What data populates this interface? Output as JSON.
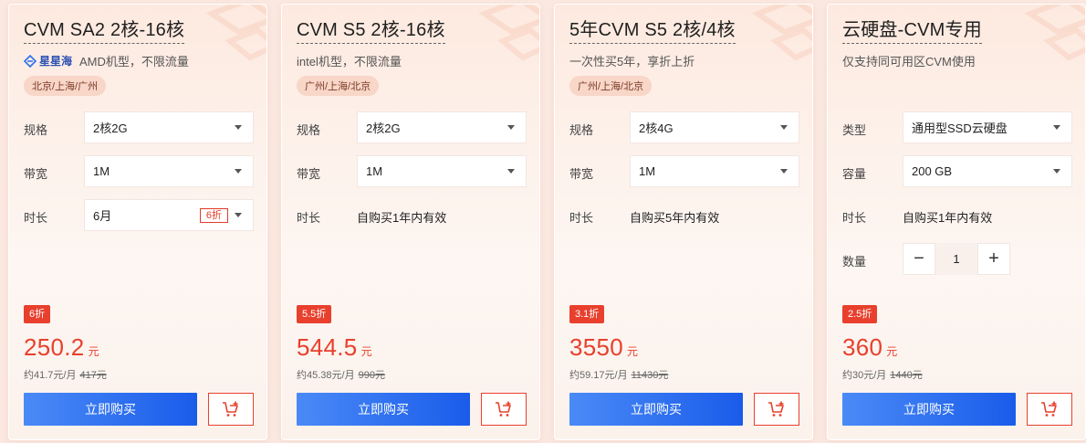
{
  "colors": {
    "accent": "#e8402d",
    "button_blue": "#1a5cea",
    "region_bg": "#f8d6c8"
  },
  "cards": [
    {
      "title": "CVM SA2 2核-16核",
      "brand": "星星海",
      "subtitle": "AMD机型，不限流量",
      "region": "北京/上海/广州",
      "spec_label": "规格",
      "spec_value": "2核2G",
      "bandwidth_label": "带宽",
      "bandwidth_value": "1M",
      "duration_label": "时长",
      "duration_value": "6月",
      "duration_tag": "6折",
      "discount": "6折",
      "price": "250.2",
      "price_unit": "元",
      "per_month": "约41.7元/月",
      "original": "417元",
      "buy_label": "立即购买"
    },
    {
      "title": "CVM S5 2核-16核",
      "subtitle": "intel机型，不限流量",
      "region": "广州/上海/北京",
      "spec_label": "规格",
      "spec_value": "2核2G",
      "bandwidth_label": "带宽",
      "bandwidth_value": "1M",
      "duration_label": "时长",
      "duration_value": "自购买1年内有效",
      "discount": "5.5折",
      "price": "544.5",
      "price_unit": "元",
      "per_month": "约45.38元/月",
      "original": "990元",
      "buy_label": "立即购买"
    },
    {
      "title": "5年CVM S5 2核/4核",
      "subtitle": "一次性买5年，享折上折",
      "region": "广州/上海/北京",
      "spec_label": "规格",
      "spec_value": "2核4G",
      "bandwidth_label": "带宽",
      "bandwidth_value": "1M",
      "duration_label": "时长",
      "duration_value": "自购买5年内有效",
      "discount": "3.1折",
      "price": "3550",
      "price_unit": "元",
      "per_month": "约59.17元/月",
      "original": "11430元",
      "buy_label": "立即购买"
    },
    {
      "title": "云硬盘-CVM专用",
      "subtitle": "仅支持同可用区CVM使用",
      "type_label": "类型",
      "type_value": "通用型SSD云硬盘",
      "capacity_label": "容量",
      "capacity_value": "200 GB",
      "duration_label": "时长",
      "duration_value": "自购买1年内有效",
      "quantity_label": "数量",
      "quantity_value": "1",
      "minus": "−",
      "plus": "+",
      "discount": "2.5折",
      "price": "360",
      "price_unit": "元",
      "per_month": "约30元/月",
      "original": "1440元",
      "buy_label": "立即购买"
    }
  ]
}
